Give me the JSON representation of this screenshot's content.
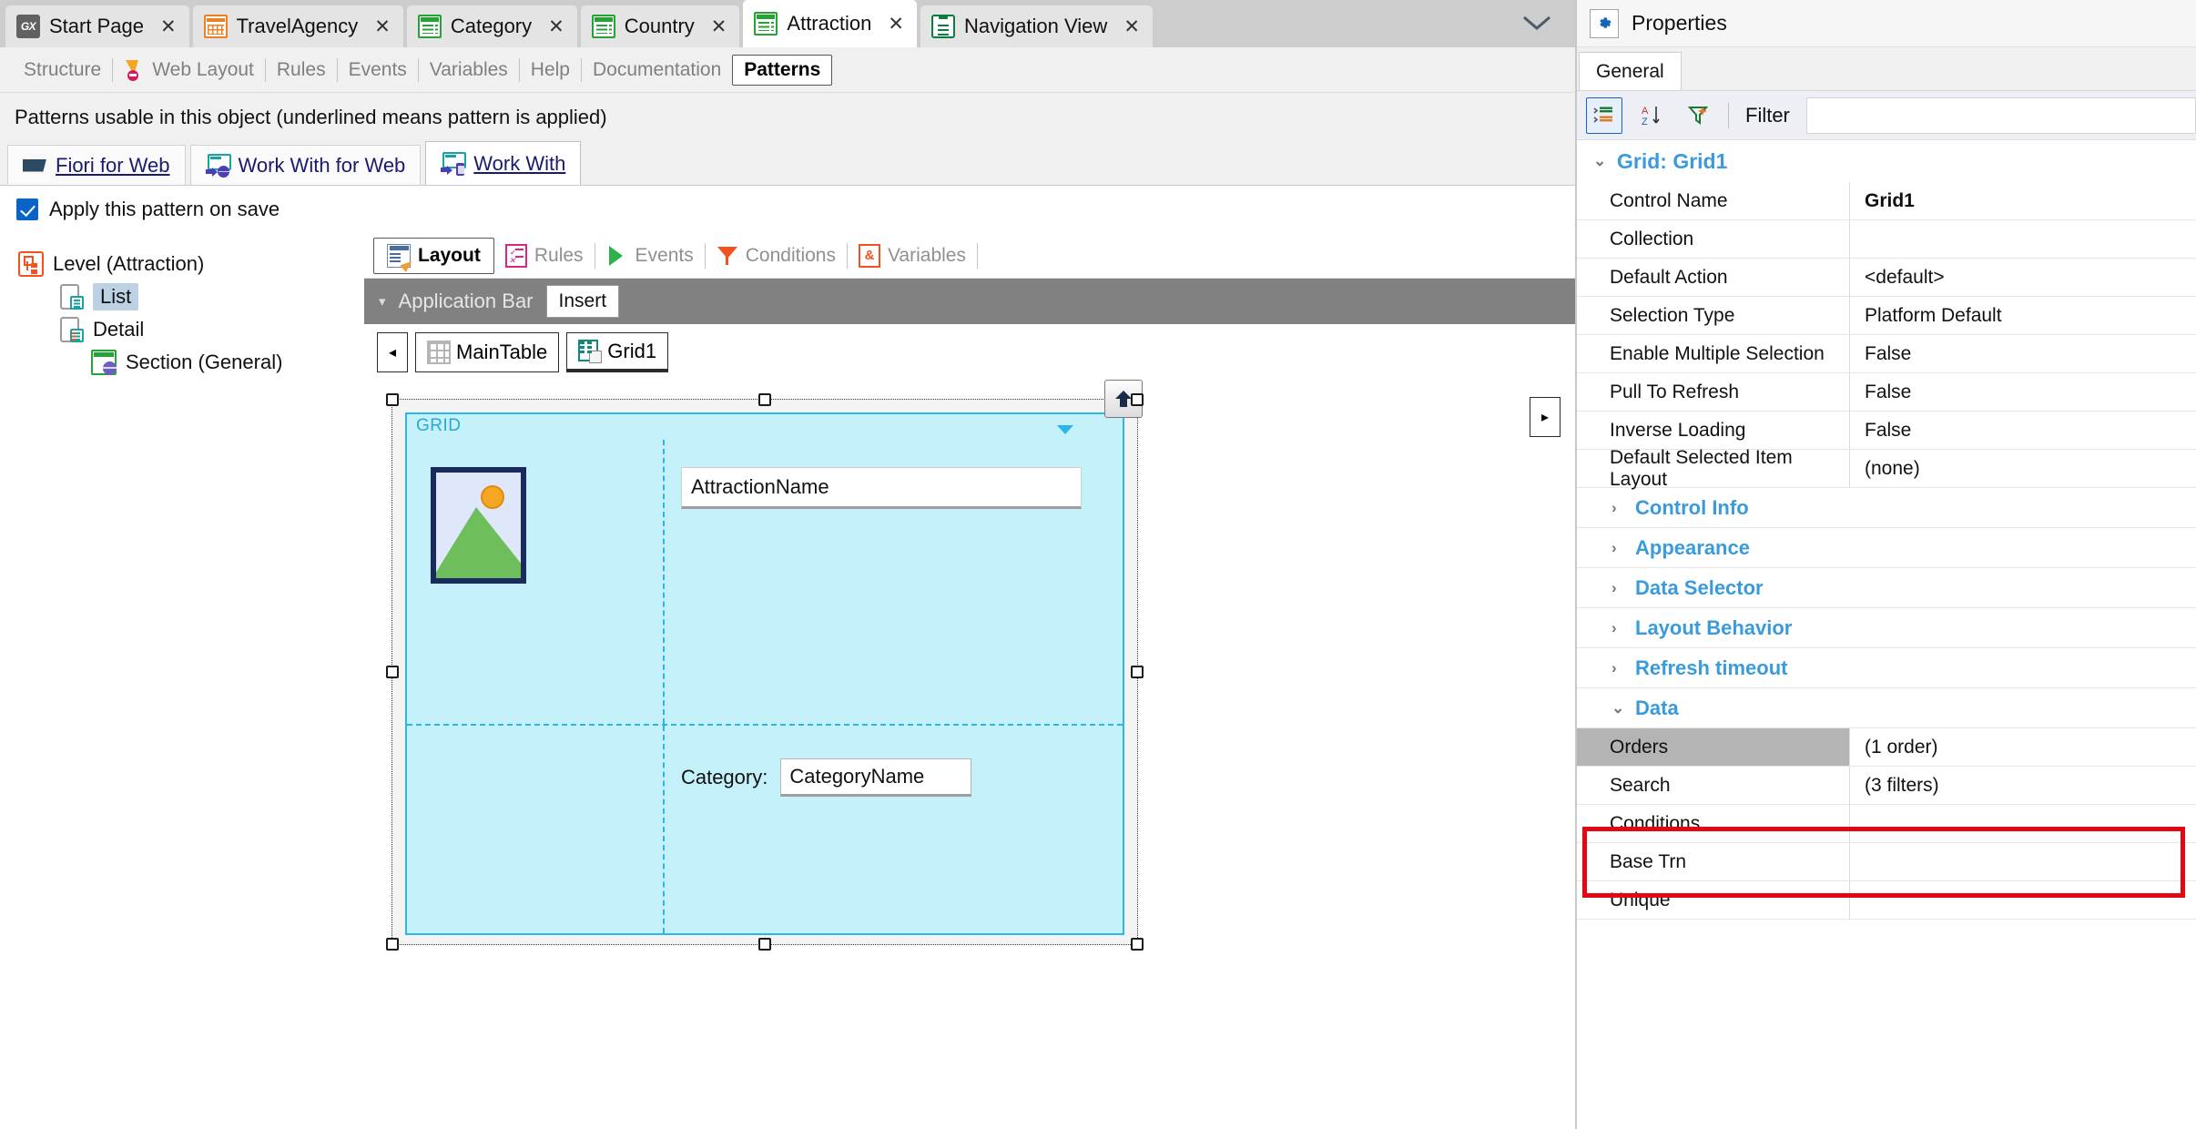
{
  "tabstrip": {
    "tabs": [
      {
        "label": "Start Page",
        "icon": "gx-logo-icon",
        "close": "✕",
        "active": false
      },
      {
        "label": "TravelAgency",
        "icon": "transaction-icon",
        "close": "✕",
        "active": false
      },
      {
        "label": "Category",
        "icon": "webpanel-icon",
        "close": "✕",
        "active": false
      },
      {
        "label": "Country",
        "icon": "webpanel-icon",
        "close": "✕",
        "active": false
      },
      {
        "label": "Attraction",
        "icon": "webpanel-icon",
        "close": "✕",
        "active": true
      },
      {
        "label": "Navigation View",
        "icon": "navigation-view-icon",
        "close": "✕",
        "active": false
      }
    ],
    "overflow_icon": "chevron-down-icon",
    "gx_logo_text": "GX"
  },
  "objecttabs": {
    "items": [
      {
        "label": "Structure",
        "bold": false,
        "icon": null
      },
      {
        "label": "Web Layout",
        "bold": false,
        "icon": "web-layout-icon"
      },
      {
        "label": "Rules",
        "bold": false,
        "icon": null
      },
      {
        "label": "Events",
        "bold": false,
        "icon": null
      },
      {
        "label": "Variables",
        "bold": false,
        "icon": null
      },
      {
        "label": "Help",
        "bold": false,
        "icon": null
      },
      {
        "label": "Documentation",
        "bold": false,
        "icon": null
      },
      {
        "label": "Patterns",
        "bold": true,
        "icon": null
      }
    ]
  },
  "patterns": {
    "caption": "Patterns usable in this object (underlined means pattern is applied)",
    "tabs": [
      {
        "label": "Fiori for Web",
        "icon": "fiori-icon",
        "underlined": true,
        "active": false
      },
      {
        "label": "Work With for Web",
        "icon": "work-with-web-icon",
        "underlined": false,
        "active": false
      },
      {
        "label": "Work With",
        "icon": "work-with-mobile-icon",
        "underlined": true,
        "active": true
      }
    ],
    "apply_checkbox": {
      "label": "Apply this pattern on save",
      "checked": true,
      "color": "#0a64c8"
    }
  },
  "tree": {
    "nodes": [
      {
        "label": "Level (Attraction)",
        "icon": "level-icon",
        "level": 1,
        "selected": false
      },
      {
        "label": "List",
        "icon": "list-node-icon",
        "level": 2,
        "selected": true
      },
      {
        "label": "Detail",
        "icon": "detail-node-icon",
        "level": 2,
        "selected": false
      },
      {
        "label": "Section (General)",
        "icon": "section-icon",
        "level": 3,
        "selected": false
      }
    ]
  },
  "designer": {
    "tabs": [
      {
        "label": "Layout",
        "icon": "layout-icon",
        "active": true
      },
      {
        "label": "Rules",
        "icon": "rules-icon",
        "active": false
      },
      {
        "label": "Events",
        "icon": "events-icon",
        "active": false
      },
      {
        "label": "Conditions",
        "icon": "conditions-icon",
        "active": false
      },
      {
        "label": "Variables",
        "icon": "variables-icon",
        "active": false
      }
    ],
    "appbar": {
      "label": "Application Bar",
      "caret": "▾",
      "insert_button": "Insert"
    },
    "breadcrumb": {
      "back_arrow": "◂",
      "forward_arrow": "▸",
      "items": [
        {
          "label": "MainTable",
          "icon": "maintable-icon",
          "selected": false
        },
        {
          "label": "Grid1",
          "icon": "grid-icon",
          "selected": true
        }
      ]
    },
    "canvas": {
      "grid_label": "GRID",
      "up_arrow_icon": "arrow-up-icon",
      "dropdown_caret_icon": "caret-down-icon",
      "image_placeholder_icon": "image-placeholder-icon",
      "attraction_name_field": "AttractionName",
      "category_label": "Category:",
      "category_name_field": "CategoryName"
    }
  },
  "properties": {
    "header": {
      "title": "Properties",
      "icon": "gear-icon"
    },
    "tab": "General",
    "toolbar": {
      "categorized_icon": "categorized-list-icon",
      "alphabetical_icon": "sort-az-icon",
      "filter_icon": "funnel-icon",
      "filter_label": "Filter",
      "filter_value": ""
    },
    "group_title": "Grid: Grid1",
    "group_caret": "⌄",
    "rows": [
      {
        "name": "Control Name",
        "value": "Grid1",
        "bold": true,
        "selected": false
      },
      {
        "name": "Collection",
        "value": "",
        "bold": false,
        "selected": false
      },
      {
        "name": "Default Action",
        "value": "<default>",
        "bold": false,
        "selected": false
      },
      {
        "name": "Selection Type",
        "value": "Platform Default",
        "bold": false,
        "selected": false
      },
      {
        "name": "Enable Multiple Selection",
        "value": "False",
        "bold": false,
        "selected": false
      },
      {
        "name": "Pull To Refresh",
        "value": "False",
        "bold": false,
        "selected": false
      },
      {
        "name": "Inverse Loading",
        "value": "False",
        "bold": false,
        "selected": false
      },
      {
        "name": "Default Selected Item Layout",
        "value": "(none)",
        "bold": false,
        "selected": false
      }
    ],
    "subgroups": [
      {
        "label": "Control Info",
        "caret": "›"
      },
      {
        "label": "Appearance",
        "caret": "›"
      },
      {
        "label": "Data Selector",
        "caret": "›"
      },
      {
        "label": "Layout Behavior",
        "caret": "›"
      },
      {
        "label": "Refresh timeout",
        "caret": "›"
      }
    ],
    "data_group": {
      "label": "Data",
      "caret": "⌄"
    },
    "data_rows": [
      {
        "name": "Orders",
        "value": "(1 order)",
        "selected": true
      },
      {
        "name": "Search",
        "value": "(3 filters)",
        "selected": false
      },
      {
        "name": "Conditions",
        "value": "",
        "selected": false
      },
      {
        "name": "Base Trn",
        "value": "",
        "selected": false
      },
      {
        "name": "Unique",
        "value": "",
        "selected": false
      }
    ],
    "highlight_color": "#e30613"
  }
}
